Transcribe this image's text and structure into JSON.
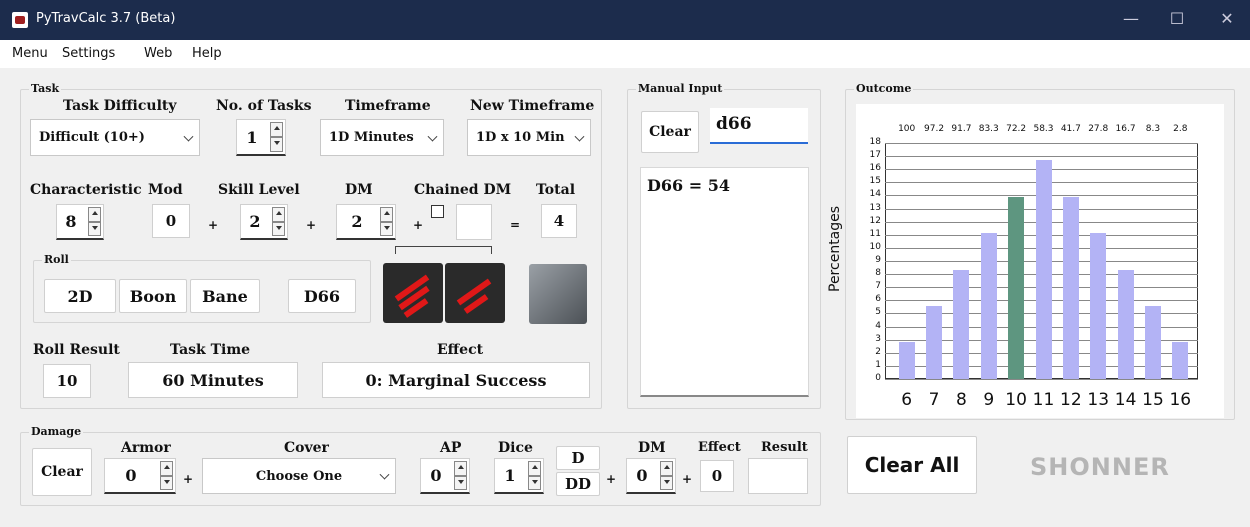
{
  "window": {
    "title": "PyTravCalc 3.7 (Beta)",
    "minimize": "—",
    "maximize": "☐",
    "close": "✕"
  },
  "menu": [
    "Menu",
    "Settings",
    "Web",
    "Help"
  ],
  "task": {
    "group_title": "Task",
    "difficulty_label": "Task Difficulty",
    "difficulty_value": "Difficult (10+)",
    "num_tasks_label": "No. of Tasks",
    "num_tasks_value": "1",
    "timeframe_label": "Timeframe",
    "timeframe_value": "1D Minutes",
    "new_timeframe_label": "New Timeframe",
    "new_timeframe_value": "1D x 10 Min",
    "characteristic_label": "Characteristic",
    "characteristic_value": "8",
    "mod_label": "Mod",
    "mod_value": "0",
    "skill_label": "Skill Level",
    "skill_value": "2",
    "dm_label": "DM",
    "dm_value": "2",
    "chained_label": "Chained DM",
    "chained_value": "",
    "total_label": "Total",
    "total_value": "4",
    "plus": "+",
    "equals": "=",
    "roll_title": "Roll",
    "roll_buttons": [
      "2D",
      "Boon",
      "Bane",
      "D66"
    ],
    "roll_result_label": "Roll Result",
    "roll_result_value": "10",
    "task_time_label": "Task Time",
    "task_time_value": "60 Minutes",
    "effect_label": "Effect",
    "effect_value": "0: Marginal Success"
  },
  "manual": {
    "group_title": "Manual Input",
    "clear": "Clear",
    "input_value": "d66",
    "output": "D66 = 54"
  },
  "outcome": {
    "group_title": "Outcome"
  },
  "chart_data": {
    "type": "bar",
    "categories": [
      "6",
      "7",
      "8",
      "9",
      "10",
      "11",
      "12",
      "13",
      "14",
      "15",
      "16"
    ],
    "values": [
      2.8,
      5.6,
      8.3,
      11.1,
      13.9,
      16.7,
      13.9,
      11.1,
      8.3,
      5.6,
      2.8
    ],
    "top_labels": [
      "100",
      "97.2",
      "91.7",
      "83.3",
      "72.2",
      "58.3",
      "41.7",
      "27.8",
      "16.7",
      "8.3",
      "2.8"
    ],
    "ylabel": "Percentages",
    "ylim": [
      0,
      18
    ],
    "yticks": [
      "0",
      "1",
      "2",
      "3",
      "4",
      "5",
      "6",
      "7",
      "8",
      "9",
      "10",
      "11",
      "12",
      "13",
      "14",
      "15",
      "16",
      "17",
      "18"
    ],
    "highlight_index": 4,
    "bar_color": "#b3b3f5",
    "highlight_color": "#5e9680",
    "grid": true
  },
  "damage": {
    "group_title": "Damage",
    "clear": "Clear",
    "armor_label": "Armor",
    "armor_value": "0",
    "cover_label": "Cover",
    "cover_value": "Choose One",
    "ap_label": "AP",
    "ap_value": "0",
    "dice_label": "Dice",
    "dice_value": "1",
    "d_button": "D",
    "dd_button": "DD",
    "dm_label": "DM",
    "dm_value": "0",
    "effect_label": "Effect",
    "effect_value": "0",
    "result_label": "Result",
    "result_value": "",
    "plus": "+"
  },
  "clear_all": "Clear All",
  "logo": "SHONNER"
}
